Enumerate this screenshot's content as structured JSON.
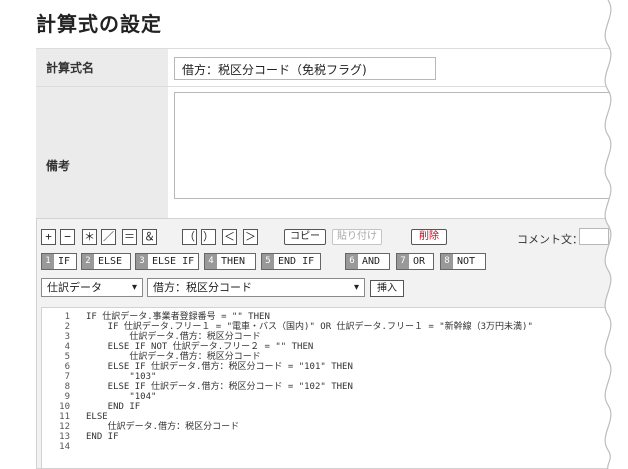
{
  "page": {
    "title": "計算式の設定"
  },
  "form": {
    "name_label": "計算式名",
    "name_value": "借方：税区分コード（免税フラグ)",
    "note_label": "備考",
    "note_value": ""
  },
  "toolbar": {
    "operators": [
      "+",
      "−",
      "＊",
      "／",
      "＝",
      "＆",
      "（",
      "）",
      "＜",
      "＞"
    ],
    "copy_label": "コピー",
    "paste_label": "貼り付け",
    "delete_label": "削除",
    "comment_label": "コメント文："
  },
  "keywords": [
    {
      "num": "1",
      "label": "IF"
    },
    {
      "num": "2",
      "label": "ELSE"
    },
    {
      "num": "3",
      "label": "ELSE IF"
    },
    {
      "num": "4",
      "label": "THEN"
    },
    {
      "num": "5",
      "label": "END IF"
    },
    {
      "num": "6",
      "label": "AND"
    },
    {
      "num": "7",
      "label": "OR"
    },
    {
      "num": "8",
      "label": "NOT"
    }
  ],
  "selectors": {
    "category": "仕訳データ",
    "field": "借方：税区分コード",
    "insert_label": "挿入"
  },
  "code": [
    {
      "ln": "1",
      "text": "IF 仕訳データ.事業者登録番号 = \"\" THEN"
    },
    {
      "ln": "2",
      "text": "    IF 仕訳データ.フリー１ = \"電車・バス（国内)\" OR 仕訳データ.フリー１ = \"新幹線（3万円未満)\""
    },
    {
      "ln": "3",
      "text": "        仕訳データ.借方：税区分コード"
    },
    {
      "ln": "4",
      "text": "    ELSE IF NOT 仕訳データ.フリー２ = \"\" THEN"
    },
    {
      "ln": "5",
      "text": "        仕訳データ.借方：税区分コード"
    },
    {
      "ln": "6",
      "text": "    ELSE IF 仕訳データ.借方：税区分コード = \"101\" THEN"
    },
    {
      "ln": "7",
      "text": "        \"103\""
    },
    {
      "ln": "8",
      "text": "    ELSE IF 仕訳データ.借方：税区分コード = \"102\" THEN"
    },
    {
      "ln": "9",
      "text": "        \"104\""
    },
    {
      "ln": "10",
      "text": "    END IF"
    },
    {
      "ln": "11",
      "text": "ELSE"
    },
    {
      "ln": "12",
      "text": "    仕訳データ.借方：税区分コード"
    },
    {
      "ln": "13",
      "text": "END IF"
    },
    {
      "ln": "14",
      "text": ""
    }
  ]
}
